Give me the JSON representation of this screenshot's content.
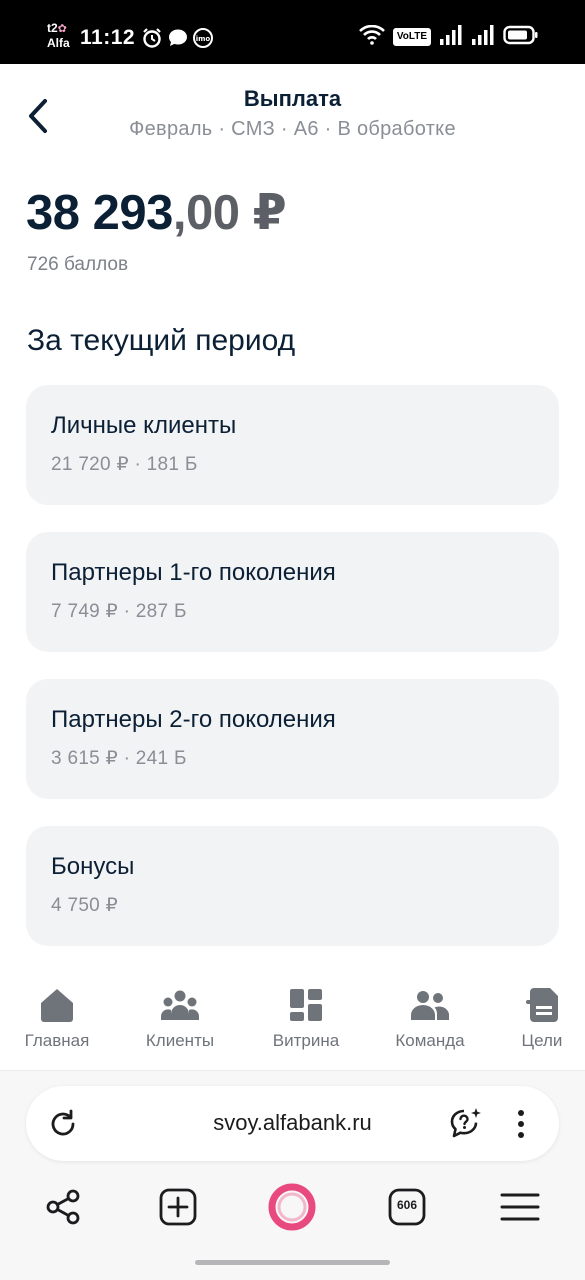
{
  "status_bar": {
    "carrier_top": "t2",
    "carrier_bottom": "Alfa",
    "time": "11:12",
    "volte": "VoLTE",
    "icons": [
      "alarm-icon",
      "chat-bubble-icon",
      "imo-icon",
      "wifi-icon",
      "volte-icon",
      "signal-icon",
      "signal-icon",
      "battery-icon"
    ]
  },
  "header": {
    "title": "Выплата",
    "subtitle": "Февраль · СМЗ · А6 · В обработке",
    "back_icon": "chevron-left-icon"
  },
  "summary": {
    "amount_main": "38 293",
    "amount_kop": ",00",
    "currency": " ₽",
    "points": "726 баллов"
  },
  "section_title": "За текущий период",
  "cards": [
    {
      "title": "Личные клиенты",
      "subtitle": "21 720 ₽ · 181 Б"
    },
    {
      "title": "Партнеры 1-го поколения",
      "subtitle": "7 749 ₽ · 287 Б"
    },
    {
      "title": "Партнеры 2-го поколения",
      "subtitle": "3 615 ₽ · 241 Б"
    },
    {
      "title": "Бонусы",
      "subtitle": "4 750 ₽"
    }
  ],
  "nav": {
    "items": [
      {
        "label": "Главная",
        "icon": "home-icon"
      },
      {
        "label": "Клиенты",
        "icon": "clients-icon"
      },
      {
        "label": "Витрина",
        "icon": "showcase-icon"
      },
      {
        "label": "Команда",
        "icon": "team-icon"
      },
      {
        "label": "Цели",
        "icon": "goals-icon"
      }
    ]
  },
  "browser": {
    "url": "svoy.alfabank.ru",
    "tabs_count": "606",
    "icons": [
      "reload-icon",
      "help-sparkle-icon",
      "more-vertical-icon",
      "share-icon",
      "new-tab-icon",
      "alice-icon",
      "tabs-icon",
      "menu-icon"
    ]
  },
  "colors": {
    "text_primary": "#0b1f35",
    "text_secondary": "#8a8e95",
    "card_bg": "#f2f3f5",
    "nav_icon": "#6f747b",
    "alice_accent": "#e84a7f"
  }
}
